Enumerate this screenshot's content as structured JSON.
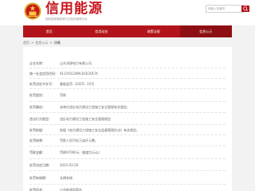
{
  "header": {
    "title": "信用能源",
    "subtitle": "国家能源局能源行业信用管理平台",
    "search_placeholder": "请输入关键词"
  },
  "nav": {
    "items": [
      {
        "label": "首页",
        "active": false
      },
      {
        "label": "信用动态",
        "active": false
      },
      {
        "label": "政策法规",
        "active": false
      },
      {
        "label": "信息公示",
        "active": true
      }
    ]
  },
  "breadcrumb": {
    "home": "首页",
    "section": "信息公示",
    "current": "详情"
  },
  "details": {
    "rows": [
      {
        "label": "企业名称：",
        "value": "山东鸿源电力有限公司"
      },
      {
        "label": "统一社会信用代码：",
        "value": "91370523MA3X3CKR7A"
      },
      {
        "label": "处罚决定书文号：",
        "value": "鲁能监罚（2025）22号"
      },
      {
        "label": "处罚类别：",
        "value": "罚款"
      },
      {
        "label": "处罚事由：",
        "value": "该单位违反电力建设工程施工安全管理有关规定。"
      },
      {
        "label": "违法行为类型：",
        "value": "违反电力建设工程施工安全管理规定"
      },
      {
        "label": "处罚依据：",
        "value": "依据《电力建设工程施工安全监督管理办法》有关规定。"
      },
      {
        "label": "处罚结果：",
        "value": "罚款人民币玖万柒仟元整。"
      },
      {
        "label": "罚款金额：",
        "value": "罚款97000元（额度均元以）"
      },
      {
        "label": "处罚决定日期：",
        "value": "2025-03-26"
      },
      {
        "label": "处罚有效期：",
        "value": "长期有效"
      },
      {
        "label": "处罚机关：",
        "value": "山东能源监管办"
      }
    ]
  },
  "colors": {
    "brand_red": "#c8161e",
    "nav_red": "#b3141b",
    "nav_active": "#8d0f14"
  }
}
